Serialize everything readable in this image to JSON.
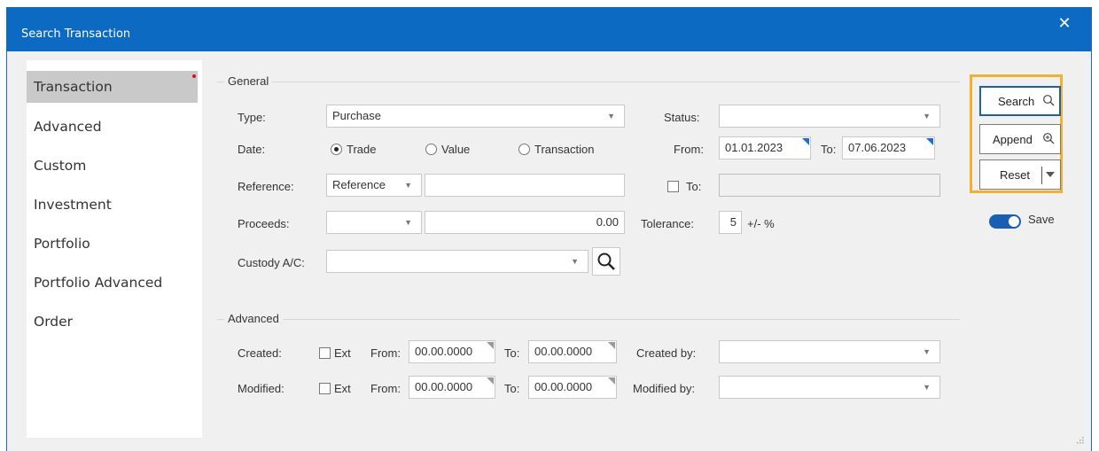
{
  "window": {
    "title": "Search Transaction",
    "close_icon": "close-icon",
    "accent": "#0c6ac3",
    "highlight": "#f2b02c"
  },
  "nav": {
    "items": [
      {
        "label": "Transaction",
        "active": true
      },
      {
        "label": "Advanced"
      },
      {
        "label": "Custom"
      },
      {
        "label": "Investment"
      },
      {
        "label": "Portfolio"
      },
      {
        "label": "Portfolio Advanced"
      },
      {
        "label": "Order"
      }
    ]
  },
  "general": {
    "title": "General",
    "type_label": "Type:",
    "type_value": "Purchase",
    "status_label": "Status:",
    "status_value": "",
    "date_label": "Date:",
    "date_options": [
      "Trade",
      "Value",
      "Transaction"
    ],
    "date_selected": "Trade",
    "from_label": "From:",
    "from_value": "01.01.2023",
    "to_label": "To:",
    "to_value": "07.06.2023",
    "reference_label": "Reference:",
    "reference_type": "Reference",
    "reference_value": "",
    "reference_to_label": "To:",
    "reference_to_value": "",
    "proceeds_label": "Proceeds:",
    "proceeds_type": "",
    "proceeds_value": "0.00",
    "tolerance_label": "Tolerance:",
    "tolerance_value": "5",
    "tolerance_unit": "+/- %",
    "custody_label": "Custody A/C:",
    "custody_value": ""
  },
  "advanced": {
    "title": "Advanced",
    "created_label": "Created:",
    "modified_label": "Modified:",
    "ext_label": "Ext",
    "from_label": "From:",
    "to_label": "To:",
    "created_from": "00.00.0000",
    "created_to": "00.00.0000",
    "modified_from": "00.00.0000",
    "modified_to": "00.00.0000",
    "created_by_label": "Created by:",
    "created_by_value": "",
    "modified_by_label": "Modified by:",
    "modified_by_value": ""
  },
  "actions": {
    "search_label": "Search",
    "append_label": "Append",
    "reset_label": "Reset",
    "save_label": "Save",
    "save_on": true
  }
}
